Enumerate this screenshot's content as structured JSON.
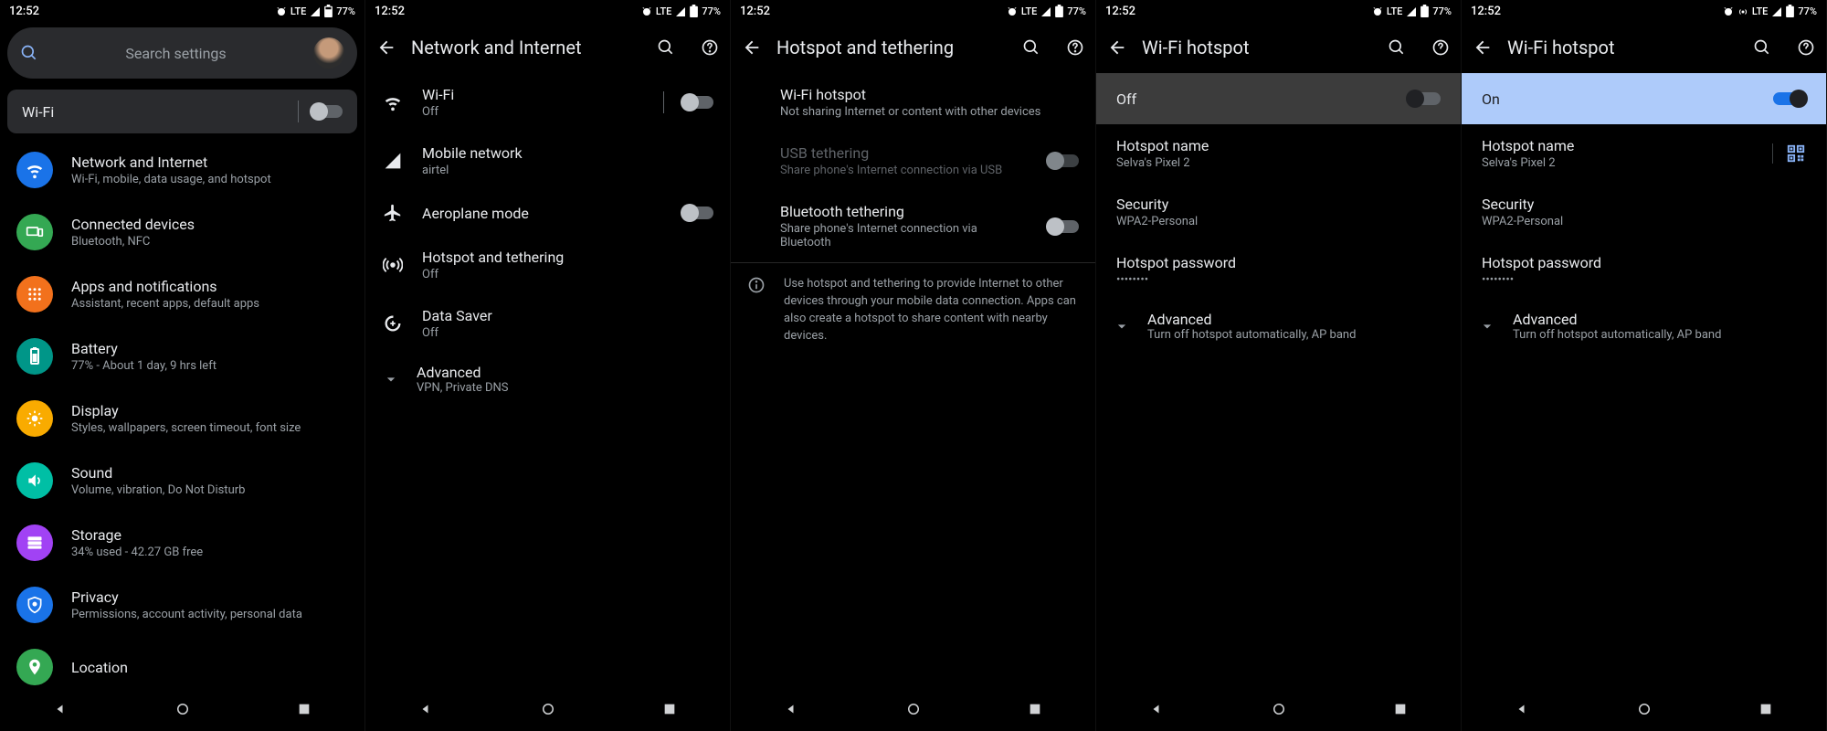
{
  "status": {
    "time": "12:52",
    "lte": "LTE",
    "battery": "77%"
  },
  "screen1": {
    "search_placeholder": "Search settings",
    "wifi_chip": "Wi-Fi",
    "items": [
      {
        "title": "Network and Internet",
        "sub": "Wi-Fi, mobile, data usage, and hotspot",
        "color": "#1a73e8",
        "icon": "wifi"
      },
      {
        "title": "Connected devices",
        "sub": "Bluetooth, NFC",
        "color": "#34a853",
        "icon": "devices"
      },
      {
        "title": "Apps and notifications",
        "sub": "Assistant, recent apps, default apps",
        "color": "#f2711c",
        "icon": "apps"
      },
      {
        "title": "Battery",
        "sub": "77% - About 1 day, 9 hrs left",
        "color": "#009688",
        "icon": "battery"
      },
      {
        "title": "Display",
        "sub": "Styles, wallpapers, screen timeout, font size",
        "color": "#f9ab00",
        "icon": "display"
      },
      {
        "title": "Sound",
        "sub": "Volume, vibration, Do Not Disturb",
        "color": "#00bfa5",
        "icon": "sound"
      },
      {
        "title": "Storage",
        "sub": "34% used - 42.27 GB free",
        "color": "#a142f4",
        "icon": "storage"
      },
      {
        "title": "Privacy",
        "sub": "Permissions, account activity, personal data",
        "color": "#1a73e8",
        "icon": "privacy"
      },
      {
        "title": "Location",
        "sub": "",
        "color": "#34a853",
        "icon": "location"
      }
    ]
  },
  "screen2": {
    "title": "Network and Internet",
    "items": [
      {
        "title": "Wi-Fi",
        "sub": "Off",
        "icon": "wifi",
        "toggle": "off"
      },
      {
        "title": "Mobile network",
        "sub": "airtel",
        "icon": "signal"
      },
      {
        "title": "Aeroplane mode",
        "sub": "",
        "icon": "airplane",
        "toggle": "off"
      },
      {
        "title": "Hotspot and tethering",
        "sub": "Off",
        "icon": "hotspot"
      },
      {
        "title": "Data Saver",
        "sub": "Off",
        "icon": "datasaver"
      }
    ],
    "advanced": {
      "title": "Advanced",
      "sub": "VPN, Private DNS"
    }
  },
  "screen3": {
    "title": "Hotspot and tethering",
    "items": [
      {
        "title": "Wi-Fi hotspot",
        "sub": "Not sharing Internet or content with other devices"
      },
      {
        "title": "USB tethering",
        "sub": "Share phone's Internet connection via USB",
        "disabled": true,
        "toggle": "off"
      },
      {
        "title": "Bluetooth tethering",
        "sub": "Share phone's Internet connection via Bluetooth",
        "toggle": "off"
      }
    ],
    "info": "Use hotspot and tethering to provide Internet to other devices through your mobile data connection. Apps can also create a hotspot to share content with nearby devices."
  },
  "screen4": {
    "title": "Wi-Fi hotspot",
    "banner": "Off",
    "hotspot_name_label": "Hotspot name",
    "hotspot_name": "Selva's Pixel 2",
    "security_label": "Security",
    "security": "WPA2-Personal",
    "password_label": "Hotspot password",
    "password": "••••••••",
    "advanced": {
      "title": "Advanced",
      "sub": "Turn off hotspot automatically, AP band"
    }
  },
  "screen5": {
    "title": "Wi-Fi hotspot",
    "banner": "On",
    "hotspot_name_label": "Hotspot name",
    "hotspot_name": "Selva's Pixel 2",
    "security_label": "Security",
    "security": "WPA2-Personal",
    "password_label": "Hotspot password",
    "password": "••••••••",
    "advanced": {
      "title": "Advanced",
      "sub": "Turn off hotspot automatically, AP band"
    }
  }
}
